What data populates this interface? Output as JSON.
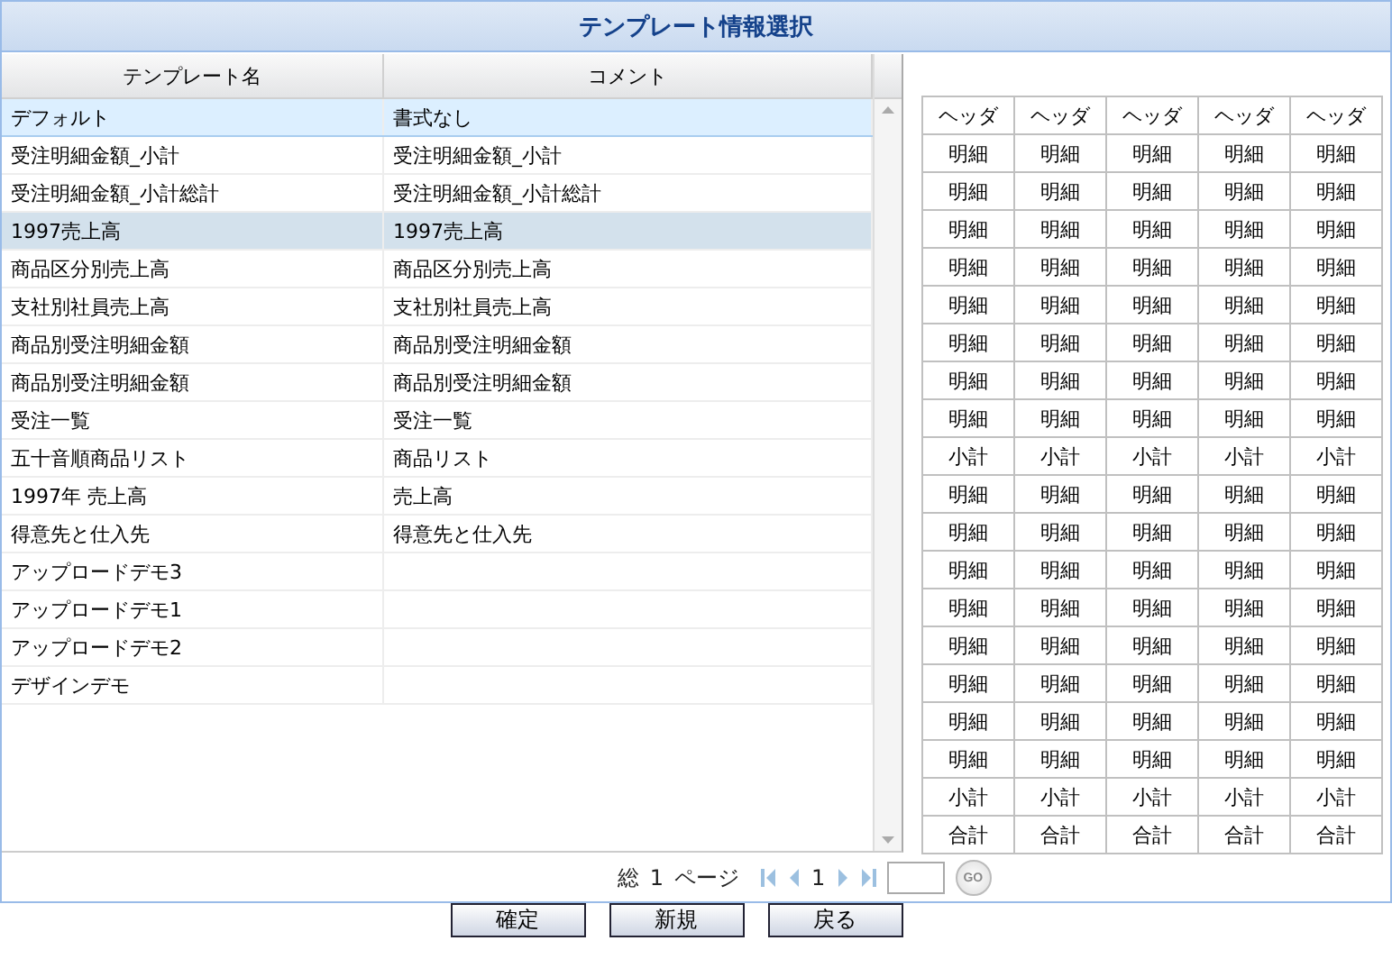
{
  "window": {
    "title": "テンプレート情報選択"
  },
  "table": {
    "columns": [
      "テンプレート名",
      "コメント"
    ],
    "rows": [
      {
        "cells": [
          "デフォルト",
          "書式なし"
        ],
        "selected": true,
        "hover": false
      },
      {
        "cells": [
          "受注明細金額_小計",
          "受注明細金額_小計"
        ],
        "selected": false,
        "hover": false
      },
      {
        "cells": [
          "受注明細金額_小計総計",
          "受注明細金額_小計総計"
        ],
        "selected": false,
        "hover": false
      },
      {
        "cells": [
          "1997売上高",
          "1997売上高"
        ],
        "selected": false,
        "hover": true
      },
      {
        "cells": [
          "商品区分別売上高",
          "商品区分別売上高"
        ],
        "selected": false,
        "hover": false
      },
      {
        "cells": [
          "支社別社員売上高",
          "支社別社員売上高"
        ],
        "selected": false,
        "hover": false
      },
      {
        "cells": [
          "商品別受注明細金額",
          "商品別受注明細金額"
        ],
        "selected": false,
        "hover": false
      },
      {
        "cells": [
          "商品別受注明細金額",
          "商品別受注明細金額"
        ],
        "selected": false,
        "hover": false
      },
      {
        "cells": [
          "受注一覧",
          "受注一覧"
        ],
        "selected": false,
        "hover": false
      },
      {
        "cells": [
          "五十音順商品リスト",
          "商品リスト"
        ],
        "selected": false,
        "hover": false
      },
      {
        "cells": [
          "1997年 売上高",
          "売上高"
        ],
        "selected": false,
        "hover": false
      },
      {
        "cells": [
          "得意先と仕入先",
          "得意先と仕入先"
        ],
        "selected": false,
        "hover": false
      },
      {
        "cells": [
          "アップロードデモ3",
          null
        ],
        "selected": false,
        "hover": false
      },
      {
        "cells": [
          "アップロードデモ1",
          null
        ],
        "selected": false,
        "hover": false
      },
      {
        "cells": [
          "アップロードデモ2",
          null
        ],
        "selected": false,
        "hover": false
      },
      {
        "cells": [
          "デザインデモ",
          null
        ],
        "selected": false,
        "hover": false
      }
    ]
  },
  "preview": {
    "header": [
      "ヘッダ",
      "ヘッダ",
      "ヘッダ",
      "ヘッダ",
      "ヘッダ"
    ],
    "rows": [
      [
        "明細",
        "明細",
        "明細",
        "明細",
        "明細"
      ],
      [
        "明細",
        "明細",
        "明細",
        "明細",
        "明細"
      ],
      [
        "明細",
        "明細",
        "明細",
        "明細",
        "明細"
      ],
      [
        "明細",
        "明細",
        "明細",
        "明細",
        "明細"
      ],
      [
        "明細",
        "明細",
        "明細",
        "明細",
        "明細"
      ],
      [
        "明細",
        "明細",
        "明細",
        "明細",
        "明細"
      ],
      [
        "明細",
        "明細",
        "明細",
        "明細",
        "明細"
      ],
      [
        "明細",
        "明細",
        "明細",
        "明細",
        "明細"
      ],
      [
        "小計",
        "小計",
        "小計",
        "小計",
        "小計"
      ],
      [
        "明細",
        "明細",
        "明細",
        "明細",
        "明細"
      ],
      [
        "明細",
        "明細",
        "明細",
        "明細",
        "明細"
      ],
      [
        "明細",
        "明細",
        "明細",
        "明細",
        "明細"
      ],
      [
        "明細",
        "明細",
        "明細",
        "明細",
        "明細"
      ],
      [
        "明細",
        "明細",
        "明細",
        "明細",
        "明細"
      ],
      [
        "明細",
        "明細",
        "明細",
        "明細",
        "明細"
      ],
      [
        "明細",
        "明細",
        "明細",
        "明細",
        "明細"
      ],
      [
        "明細",
        "明細",
        "明細",
        "明細",
        "明細"
      ],
      [
        "小計",
        "小計",
        "小計",
        "小計",
        "小計"
      ],
      [
        "合計",
        "合計",
        "合計",
        "合計",
        "合計"
      ]
    ]
  },
  "pager": {
    "prefix": "総",
    "total": "1",
    "suffix": "ページ",
    "current": "1",
    "go": "GO"
  },
  "buttons": [
    "確定",
    "新規",
    "戻る"
  ]
}
